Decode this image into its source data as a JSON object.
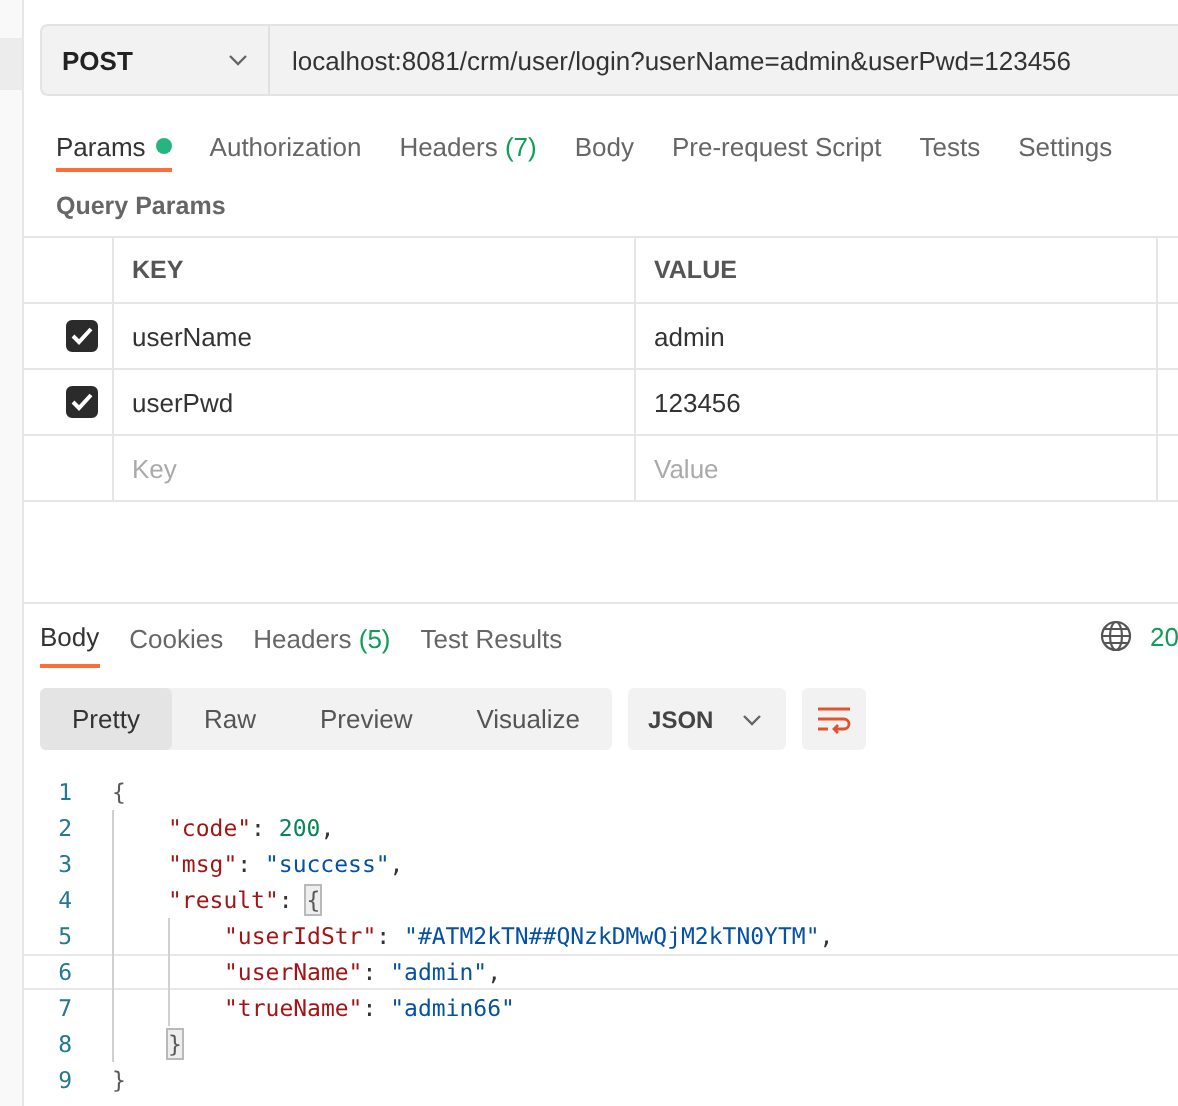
{
  "request": {
    "method": "POST",
    "url": "localhost:8081/crm/user/login?userName=admin&userPwd=123456"
  },
  "request_tabs": [
    {
      "label": "Params",
      "dot": true,
      "selected": true
    },
    {
      "label": "Authorization",
      "dot": false,
      "selected": false
    },
    {
      "label": "Headers",
      "count": "(7)",
      "dot": false,
      "selected": false
    },
    {
      "label": "Body",
      "dot": false,
      "selected": false
    },
    {
      "label": "Pre-request Script",
      "dot": false,
      "selected": false
    },
    {
      "label": "Tests",
      "dot": false,
      "selected": false
    },
    {
      "label": "Settings",
      "dot": false,
      "selected": false
    }
  ],
  "query_params": {
    "title": "Query Params",
    "columns": [
      "KEY",
      "VALUE"
    ],
    "rows": [
      {
        "checked": true,
        "key": "userName",
        "value": "admin"
      },
      {
        "checked": true,
        "key": "userPwd",
        "value": "123456"
      }
    ],
    "new_row": {
      "key_placeholder": "Key",
      "value_placeholder": "Value"
    }
  },
  "response_tabs": [
    {
      "label": "Body",
      "selected": true
    },
    {
      "label": "Cookies",
      "selected": false
    },
    {
      "label": "Headers",
      "count": "(5)",
      "selected": false
    },
    {
      "label": "Test Results",
      "selected": false
    }
  ],
  "status": "20",
  "view_modes": [
    {
      "label": "Pretty",
      "selected": true
    },
    {
      "label": "Raw",
      "selected": false
    },
    {
      "label": "Preview",
      "selected": false
    },
    {
      "label": "Visualize",
      "selected": false
    }
  ],
  "format": "JSON",
  "code_lines": [
    {
      "number": "1",
      "tokens": [
        {
          "kind": "bracket",
          "text": "{",
          "matched": false
        }
      ],
      "current": false,
      "children": [
        {
          "number": "2",
          "tokens": [
            {
              "kind": "key",
              "text": "\"code\""
            },
            {
              "kind": "punct",
              "text": ": "
            },
            {
              "kind": "number",
              "text": "200"
            },
            {
              "kind": "punct",
              "text": ","
            }
          ],
          "current": false
        },
        {
          "number": "3",
          "tokens": [
            {
              "kind": "key",
              "text": "\"msg\""
            },
            {
              "kind": "punct",
              "text": ": "
            },
            {
              "kind": "string",
              "text": "\"success\""
            },
            {
              "kind": "punct",
              "text": ","
            }
          ],
          "current": false
        },
        {
          "number": "4",
          "tokens": [
            {
              "kind": "key",
              "text": "\"result\""
            },
            {
              "kind": "punct",
              "text": ": "
            },
            {
              "kind": "bracket",
              "text": "{",
              "matched": true
            }
          ],
          "current": false,
          "children": [
            {
              "number": "5",
              "tokens": [
                {
                  "kind": "key",
                  "text": "\"userIdStr\""
                },
                {
                  "kind": "punct",
                  "text": ": "
                },
                {
                  "kind": "string",
                  "text": "\"#ATM2kTN##QNzkDMwQjM2kTN0YTM\""
                },
                {
                  "kind": "punct",
                  "text": ","
                }
              ],
              "current": false
            },
            {
              "number": "6",
              "tokens": [
                {
                  "kind": "key",
                  "text": "\"userName\""
                },
                {
                  "kind": "punct",
                  "text": ": "
                },
                {
                  "kind": "string",
                  "text": "\"admin\""
                },
                {
                  "kind": "punct",
                  "text": ","
                }
              ],
              "current": true
            },
            {
              "number": "7",
              "tokens": [
                {
                  "kind": "key",
                  "text": "\"trueName\""
                },
                {
                  "kind": "punct",
                  "text": ": "
                },
                {
                  "kind": "string",
                  "text": "\"admin66\""
                }
              ],
              "current": false
            }
          ]
        },
        {
          "number": "8",
          "tokens": [
            {
              "kind": "bracket",
              "text": "}",
              "matched": true
            }
          ],
          "current": false
        }
      ]
    },
    {
      "number": "9",
      "tokens": [
        {
          "kind": "bracket",
          "text": "}",
          "matched": false
        }
      ],
      "current": false
    }
  ]
}
